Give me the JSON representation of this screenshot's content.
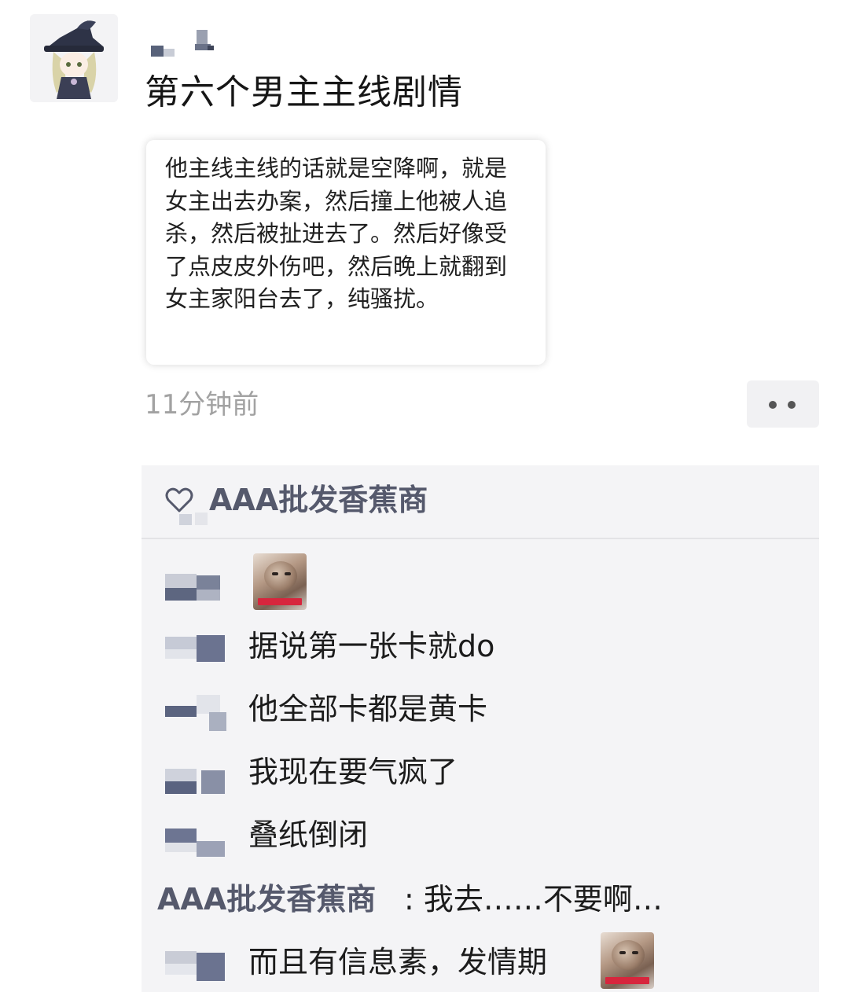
{
  "post": {
    "title": "第六个男主主线剧情",
    "quote": "他主线主线的话就是空降啊，就是女主出去办案，然后撞上他被人追杀，然后被扯进去了。然后好像受了点皮皮外伤吧，然后晚上就翻到女主家阳台去了，纯骚扰。",
    "timestamp": "11分钟前"
  },
  "likes": {
    "names": "AAA批发香蕉商"
  },
  "comments": [
    {
      "text": "",
      "sticker": "cat-sticker"
    },
    {
      "text": "据说第一张卡就do"
    },
    {
      "text": "他全部卡都是黄卡"
    },
    {
      "text": "我现在要气疯了"
    },
    {
      "text": "叠纸倒闭"
    },
    {
      "name": "AAA批发香蕉商",
      "text": ": 我去……不要啊…"
    },
    {
      "text": "而且有信息素，发情期",
      "sticker": "cat-sticker"
    }
  ],
  "colors": {
    "link_name": "#55596c",
    "panel_bg": "#f4f4f6",
    "timestamp": "#a2a2a2"
  },
  "icons": [
    "heart-icon",
    "more-icon",
    "cat-sticker"
  ]
}
